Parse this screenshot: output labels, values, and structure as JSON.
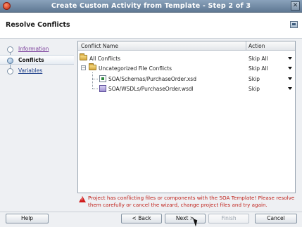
{
  "window": {
    "title": "Create Custom Activity from Template - Step 2 of 3",
    "close_glyph": "✕"
  },
  "header": {
    "title": "Resolve Conflicts",
    "icon": "help-panel-icon"
  },
  "steps": [
    {
      "label": "Information",
      "state": "done"
    },
    {
      "label": "Conflicts",
      "state": "current"
    },
    {
      "label": "Variables",
      "state": "todo"
    }
  ],
  "table": {
    "columns": [
      "Conflict Name",
      "Action"
    ],
    "rows": [
      {
        "name": "All Conflicts",
        "action": "Skip All",
        "icon": "folder-icon"
      },
      {
        "name": "Uncategorized File Conflicts",
        "action": "Skip All",
        "icon": "folder-icon",
        "toggle": "−"
      },
      {
        "name": "SOA/Schemas/PurchaseOrder.xsd",
        "action": "Skip",
        "icon": "xsd-file-icon"
      },
      {
        "name": "SOA/WSDLs/PurchaseOrder.wsdl",
        "action": "Skip",
        "icon": "wsdl-file-icon"
      }
    ]
  },
  "warning": {
    "text": "Project has conflicting files or components with the SOA Template! Please resolve them carefully or cancel the wizard, change project files and try again.",
    "color": "#c0211a"
  },
  "buttons": {
    "help": "Help",
    "back": "< Back",
    "next": "Next >",
    "finish": "Finish",
    "cancel": "Cancel"
  }
}
